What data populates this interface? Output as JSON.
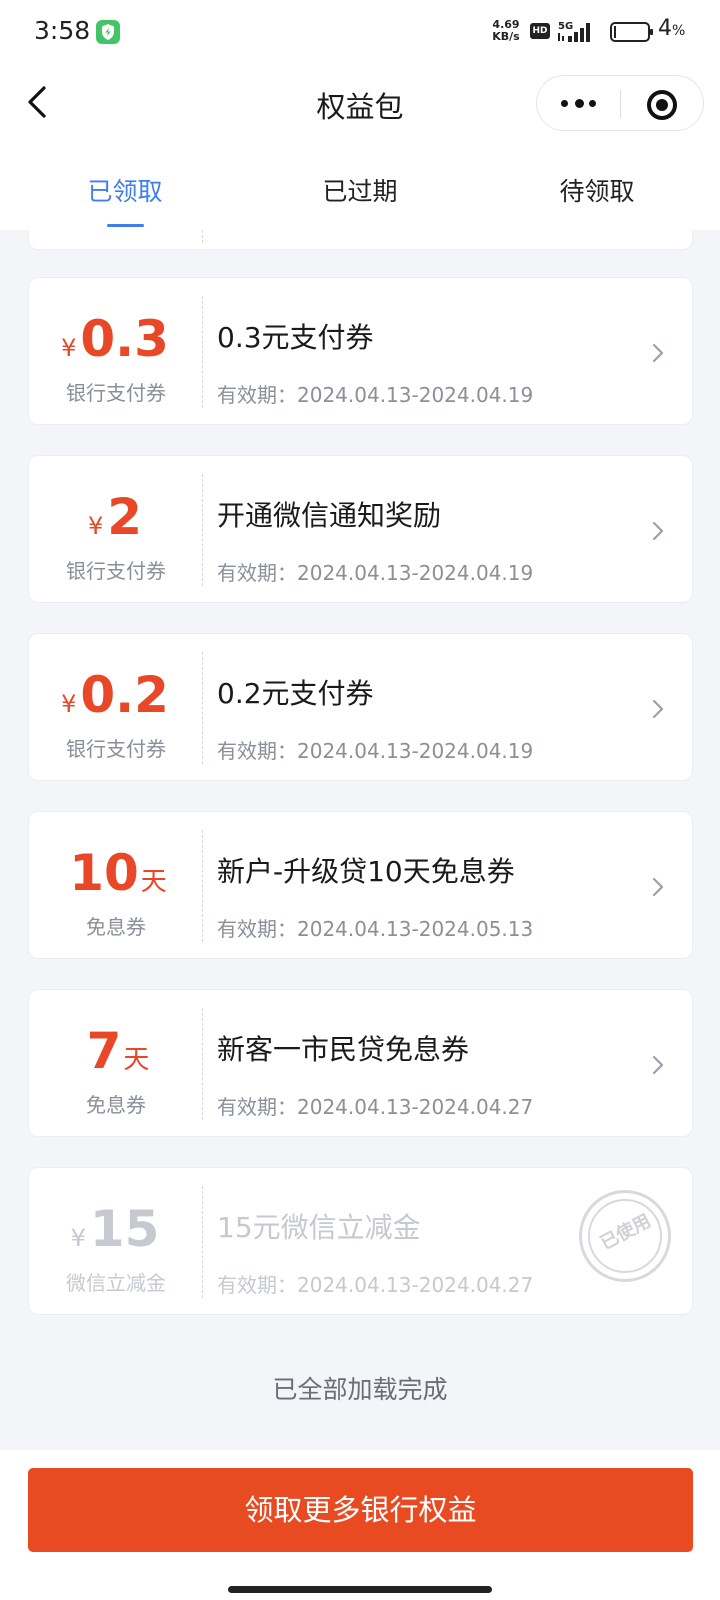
{
  "status_bar": {
    "time": "3:58",
    "net_speed_value": "4.69",
    "net_speed_unit": "KB/s",
    "hd_label": "HD",
    "network_label": "5G",
    "battery_level": "4",
    "battery_unit": "%"
  },
  "nav": {
    "title": "权益包"
  },
  "tabs": [
    {
      "label": "已领取",
      "active": true
    },
    {
      "label": "已过期",
      "active": false
    },
    {
      "label": "待领取",
      "active": false
    }
  ],
  "coupons": [
    {
      "currency": "¥",
      "amount": "0.3",
      "unit": "",
      "type": "银行支付券",
      "title": "0.3元支付券",
      "validity": "有效期：2024.04.13-2024.04.19",
      "used": false
    },
    {
      "currency": "¥",
      "amount": "2",
      "unit": "",
      "type": "银行支付券",
      "title": "开通微信通知奖励",
      "validity": "有效期：2024.04.13-2024.04.19",
      "used": false
    },
    {
      "currency": "¥",
      "amount": "0.2",
      "unit": "",
      "type": "银行支付券",
      "title": "0.2元支付券",
      "validity": "有效期：2024.04.13-2024.04.19",
      "used": false
    },
    {
      "currency": "",
      "amount": "10",
      "unit": "天",
      "type": "免息券",
      "title": "新户-升级贷10天免息券",
      "validity": "有效期：2024.04.13-2024.05.13",
      "used": false
    },
    {
      "currency": "",
      "amount": "7",
      "unit": "天",
      "type": "免息券",
      "title": "新客一市民贷免息券",
      "validity": "有效期：2024.04.13-2024.04.27",
      "used": false
    },
    {
      "currency": "¥",
      "amount": "15",
      "unit": "",
      "type": "微信立减金",
      "title": "15元微信立减金",
      "validity": "有效期：2024.04.13-2024.04.27",
      "used": true,
      "stamp": "已使用"
    }
  ],
  "list_footer": "已全部加载完成",
  "bottom": {
    "button_label": "领取更多银行权益"
  },
  "colors": {
    "accent_blue": "#3f7ef0",
    "coupon_red": "#e84828",
    "button_red": "#e84a22",
    "used_gray": "#c6c9d0"
  }
}
